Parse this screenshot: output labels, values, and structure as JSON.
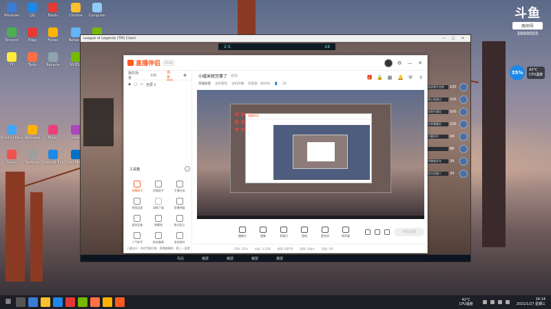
{
  "desktop": {
    "icons": [
      {
        "label": "Windows",
        "color": "#3a7bd5"
      },
      {
        "label": "QQ",
        "color": "#1e88e5"
      },
      {
        "label": "Baidu",
        "color": "#e53935"
      },
      {
        "label": "Chrome",
        "color": "#fbc02d"
      },
      {
        "label": "Computer",
        "color": "#90caf9"
      },
      {
        "label": "Tencent",
        "color": "#4caf50"
      },
      {
        "label": "Edge",
        "color": "#e53935"
      },
      {
        "label": "Folder",
        "color": "#ffb300"
      },
      {
        "label": "Network",
        "color": "#64b5f6"
      },
      {
        "label": "GeForce Experience",
        "color": "#76b900"
      },
      {
        "label": "YY",
        "color": "#ffeb3b"
      },
      {
        "label": "Tools",
        "color": "#ff7043"
      },
      {
        "label": "Recycle",
        "color": "#90a4ae"
      },
      {
        "label": "NVIDIA",
        "color": "#76b900"
      },
      {
        "label": "Steam",
        "color": "#37474f"
      },
      {
        "label": "Control Panel",
        "color": "#42a5f5"
      },
      {
        "label": "WeGame",
        "color": "#ffb300"
      },
      {
        "label": "Music",
        "color": "#ec407a"
      },
      {
        "label": "Video",
        "color": "#ab47bc"
      },
      {
        "label": "Downloads",
        "color": "#26a69a"
      },
      {
        "label": "Game",
        "color": "#ef5350"
      },
      {
        "label": "Settings",
        "color": "#9e9e9e"
      },
      {
        "label": "Internet Explorer",
        "color": "#1e88e5"
      },
      {
        "label": "Intel Media",
        "color": "#0071c5"
      },
      {
        "label": "Player",
        "color": "#ff7043"
      }
    ]
  },
  "widget": {
    "brand": "斗鱼",
    "tag": "房间号",
    "room_number": "3889005",
    "cpu_percent": "35%",
    "cpu_temp": "42°C",
    "cpu_label": "CPU温度"
  },
  "game": {
    "title": "League of Legends (TM) Client",
    "score_left": "2-5",
    "score_right": "24",
    "sidebar": [
      {
        "text": "谁说我不会的",
        "num": "100"
      },
      {
        "text": "雅心疾被过",
        "num": "100"
      },
      {
        "text": "非前行我证",
        "num": "100"
      },
      {
        "text": "也多需要好",
        "num": "100"
      },
      {
        "text": "不要的不",
        "num": "34"
      },
      {
        "text": "",
        "num": "88"
      },
      {
        "text": "明偶有好鸟",
        "num": "34"
      },
      {
        "text": "直方机器人",
        "num": "34"
      }
    ],
    "bottom": [
      "先后",
      "魔瑟",
      "魔瑟",
      "魔瑟",
      "魔瑟"
    ]
  },
  "app": {
    "logo": "直播伴侣",
    "version": "测试版",
    "left_tabs": [
      "我的场景",
      "LOL",
      "场景"
    ],
    "scene_label": "全屏 1",
    "tools_title": "工具箱",
    "tools_more": "…",
    "tools": [
      {
        "label": "弹幕助手",
        "color": "#ff5a1f",
        "hot": true
      },
      {
        "label": "房管助手",
        "color": "#888888",
        "hot": false
      },
      {
        "label": "主播任务",
        "color": "#888888",
        "hot": false
      },
      {
        "label": "视频连麦",
        "color": "#888888",
        "hot": false
      },
      {
        "label": "录像下载",
        "color": "#bbbbbb",
        "hot": false
      },
      {
        "label": "直播弹窗",
        "color": "#888888",
        "hot": false
      },
      {
        "label": "虚拟形象",
        "color": "#888888",
        "hot": false
      },
      {
        "label": "弹幕瓶",
        "color": "#888888",
        "hot": false
      },
      {
        "label": "歌词显示",
        "color": "#888888",
        "hot": false
      },
      {
        "label": "人气助手",
        "color": "#888888",
        "hot": false
      },
      {
        "label": "粉丝徽章",
        "color": "#888888",
        "hot": false
      },
      {
        "label": "游戏插件",
        "color": "#888888",
        "hot": false
      }
    ],
    "footer_left": "小墨宝贝 · 你在完美可能 · 直播偏偏的，更上一层楼",
    "room": {
      "title": "小威米就完事了",
      "edit": "修改",
      "category": "英雄联盟",
      "tag1": "主机游戏",
      "tag2": "主机开播",
      "follow": "热度值：88900",
      "count": "26"
    },
    "controls": [
      {
        "label": "摄像头"
      },
      {
        "label": "图像"
      },
      {
        "label": "多窗口"
      },
      {
        "label": "游戏"
      },
      {
        "label": "麦克风"
      },
      {
        "label": "扬声器"
      }
    ],
    "start_label": "开始直播",
    "status": [
      "CPU: 35%",
      "内存: 3.2GB",
      "帧率: 60FPS",
      "码率: 0kb/s",
      "丢帧: 0%"
    ]
  },
  "taskbar": {
    "start_icon": "windows-logo",
    "temp": "42°C",
    "temp_label": "CPU温度",
    "time": "16:14",
    "date": "2021/1/27 星期三"
  }
}
